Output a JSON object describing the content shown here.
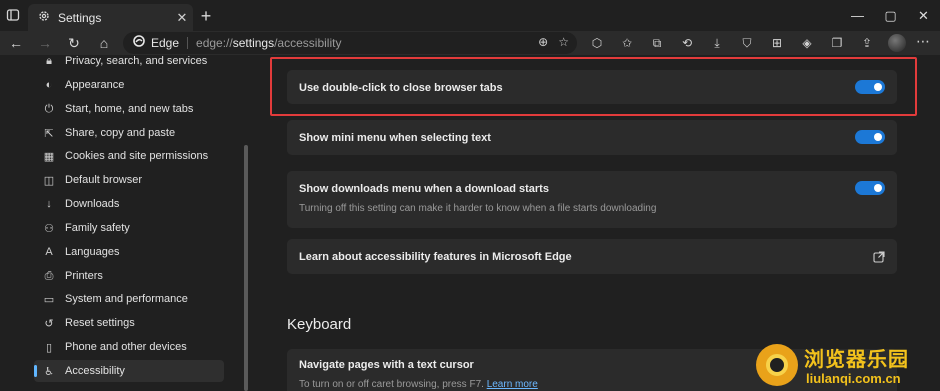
{
  "browser": {
    "tab_title": "Settings",
    "address_site": "Edge",
    "address_url_prefix": "edge://",
    "address_url_bold": "settings",
    "address_url_suffix": "/accessibility"
  },
  "sidebar": {
    "items": [
      {
        "label": "Privacy, search, and services",
        "icon": "lock-icon"
      },
      {
        "label": "Appearance",
        "icon": "palette-icon"
      },
      {
        "label": "Start, home, and new tabs",
        "icon": "power-icon"
      },
      {
        "label": "Share, copy and paste",
        "icon": "share-icon"
      },
      {
        "label": "Cookies and site permissions",
        "icon": "cookies-icon"
      },
      {
        "label": "Default browser",
        "icon": "browser-icon"
      },
      {
        "label": "Downloads",
        "icon": "download-icon"
      },
      {
        "label": "Family safety",
        "icon": "family-icon"
      },
      {
        "label": "Languages",
        "icon": "language-icon"
      },
      {
        "label": "Printers",
        "icon": "printer-icon"
      },
      {
        "label": "System and performance",
        "icon": "laptop-icon"
      },
      {
        "label": "Reset settings",
        "icon": "reset-icon"
      },
      {
        "label": "Phone and other devices",
        "icon": "phone-icon"
      },
      {
        "label": "Accessibility",
        "icon": "accessibility-icon",
        "active": true
      }
    ]
  },
  "main": {
    "settings": [
      {
        "title": "Use double-click to close browser tabs",
        "enabled": true
      },
      {
        "title": "Show mini menu when selecting text",
        "enabled": true
      },
      {
        "title": "Show downloads menu when a download starts",
        "description": "Turning off this setting can make it harder to know when a file starts downloading",
        "enabled": true
      },
      {
        "title": "Learn about accessibility features in Microsoft Edge"
      }
    ],
    "keyboard_section_title": "Keyboard",
    "keyboard_setting": {
      "title": "Navigate pages with a text cursor",
      "description": "To turn on or off caret browsing, press F7.",
      "link": "Learn more"
    }
  },
  "watermark": {
    "cn": "浏览器乐园",
    "en": "liulanqi.com.cn"
  },
  "colors": {
    "accent": "#1c78d6",
    "highlight": "#e23b3b",
    "link": "#6cb8ff"
  }
}
